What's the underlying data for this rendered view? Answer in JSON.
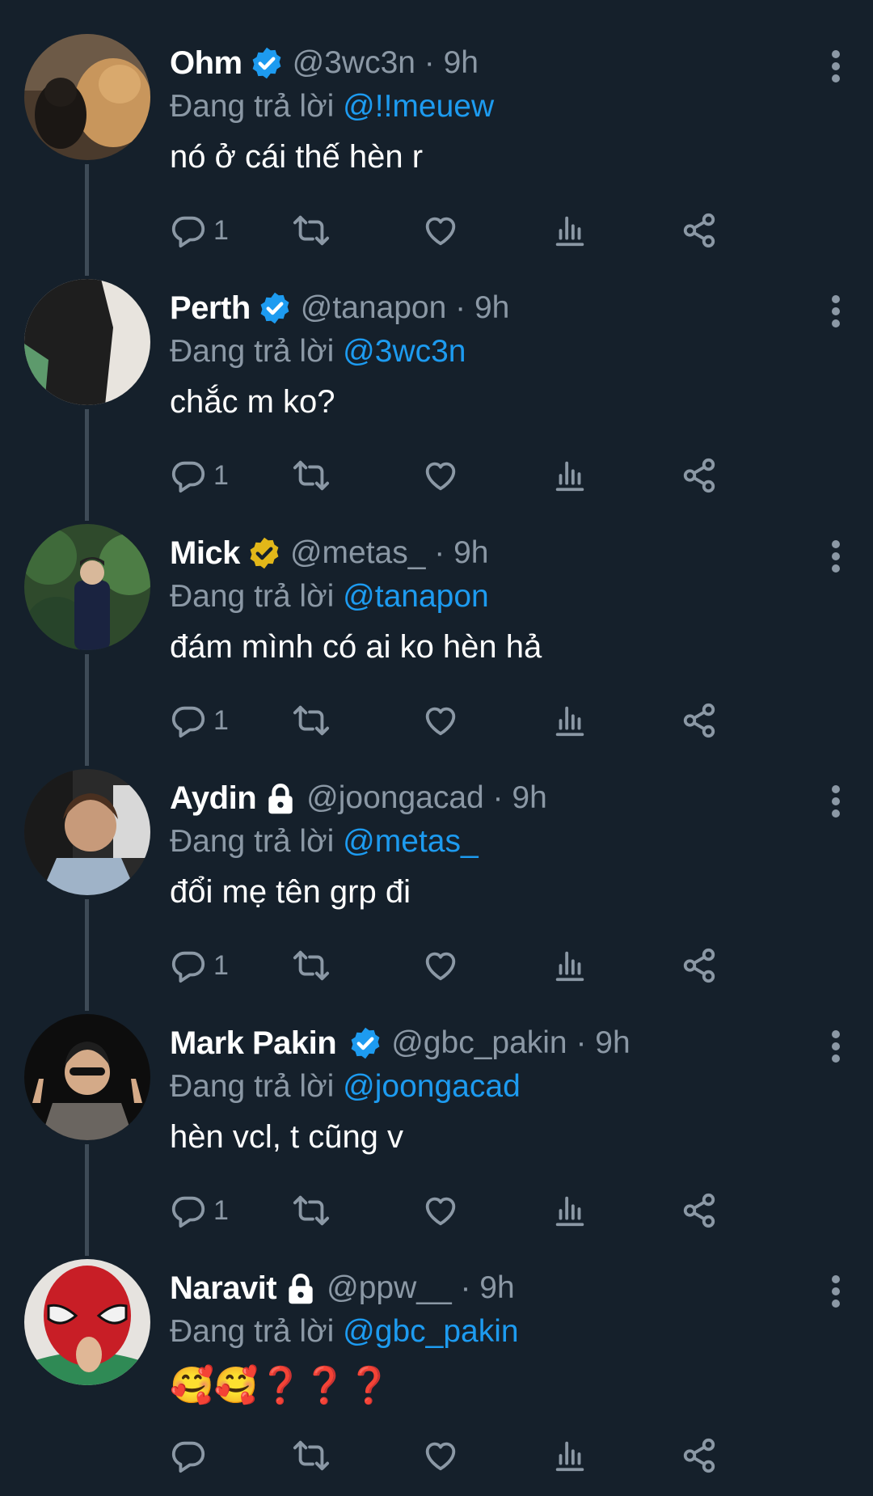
{
  "reply_prefix": "Đang trả lời",
  "colors": {
    "background": "#15202b",
    "secondary_text": "#8b98a5",
    "link": "#1d9bf0",
    "verified_blue": "#1d9bf0",
    "verified_gold": "#e2b719",
    "thread_line": "#3e4b57"
  },
  "tweets": [
    {
      "name": "Ohm",
      "badge": "verified-blue",
      "handle": "@3wc3n · 9h",
      "reply_to": "@!!meuew",
      "text": "nó ở cái thế hèn r",
      "reply_count": "1"
    },
    {
      "name": "Perth",
      "badge": "verified-blue",
      "handle": "@tanapon · 9h",
      "reply_to": "@3wc3n",
      "text": "chắc m ko?",
      "reply_count": "1"
    },
    {
      "name": "Mick",
      "badge": "verified-gold",
      "handle": "@metas_ · 9h",
      "reply_to": "@tanapon",
      "text": "đám mình có ai ko hèn hả",
      "reply_count": "1"
    },
    {
      "name": "Aydin",
      "badge": "lock",
      "handle": "@joongacad · 9h",
      "reply_to": "@metas_",
      "text": "đổi mẹ tên grp đi",
      "reply_count": "1"
    },
    {
      "name": "Mark Pakin",
      "badge": "verified-blue",
      "handle": "@gbc_pakin · 9h",
      "reply_to": "@joongacad",
      "text": "hèn vcl, t cũng v",
      "reply_count": "1"
    },
    {
      "name": "Naravit",
      "badge": "lock",
      "handle": "@ppw__ · 9h",
      "reply_to": "@gbc_pakin",
      "text": "🥰🥰❓❓❓",
      "reply_count": ""
    }
  ]
}
